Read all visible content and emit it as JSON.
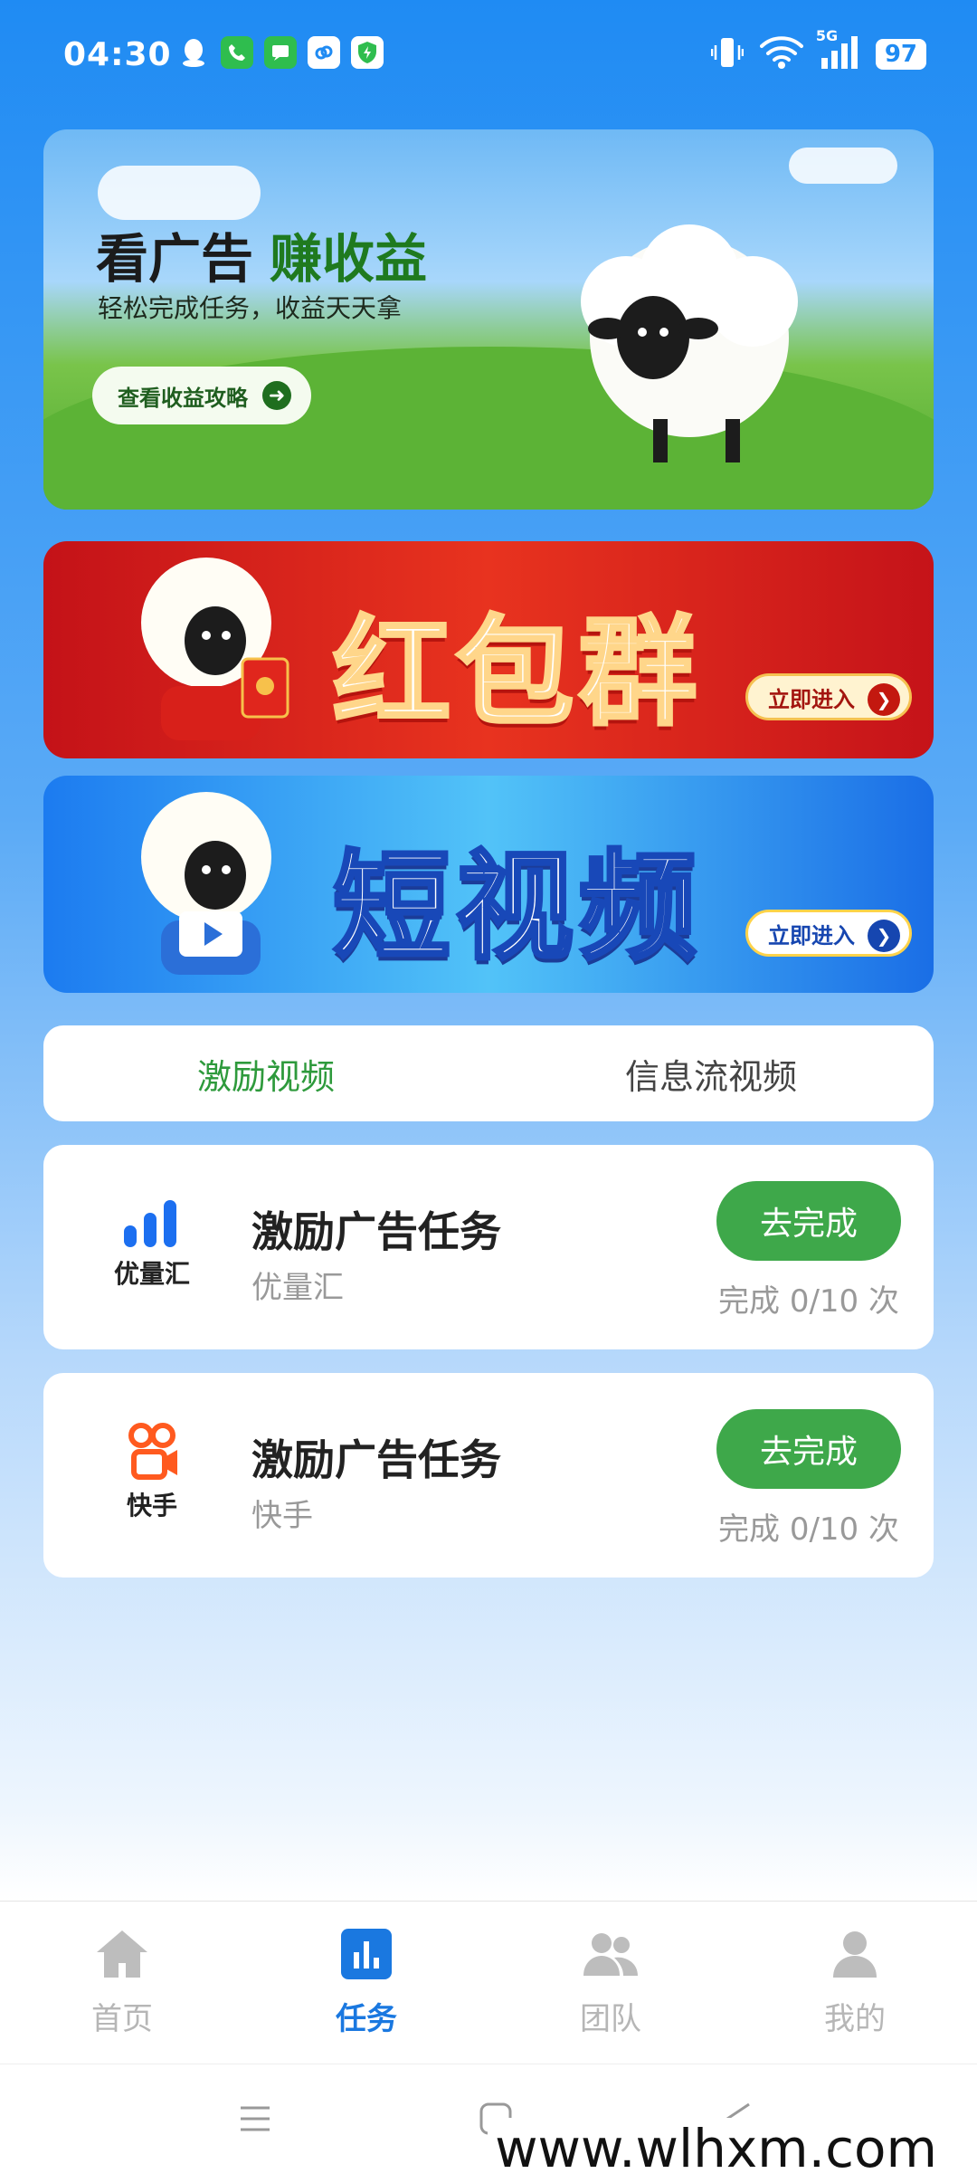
{
  "status_bar": {
    "time": "04:30",
    "battery": "97",
    "network": "5G"
  },
  "banners": {
    "earn": {
      "title_black": "看广告",
      "title_green": "赚收益",
      "subtitle": "轻松完成任务，收益天天拿",
      "button_label": "查看收益攻略"
    },
    "red_packet": {
      "title": "红包群",
      "button_label": "立即进入"
    },
    "short_video": {
      "title": "短视频",
      "button_label": "立即进入"
    }
  },
  "tabs": [
    {
      "label": "激励视频",
      "active": true
    },
    {
      "label": "信息流视频",
      "active": false
    }
  ],
  "tasks": [
    {
      "logo_label": "优量汇",
      "name": "激励广告任务",
      "source": "优量汇",
      "button_label": "去完成",
      "progress": "完成 0/10 次"
    },
    {
      "logo_label": "快手",
      "name": "激励广告任务",
      "source": "快手",
      "button_label": "去完成",
      "progress": "完成 0/10 次"
    }
  ],
  "bottom_nav": [
    {
      "label": "首页",
      "icon": "home-icon"
    },
    {
      "label": "任务",
      "icon": "task-chart-icon"
    },
    {
      "label": "团队",
      "icon": "team-icon"
    },
    {
      "label": "我的",
      "icon": "profile-icon"
    }
  ],
  "watermark": "www.wlhxm.com",
  "colors": {
    "primary_blue": "#1a78e0",
    "green": "#3ea84a",
    "tab_active": "#2e9a3c"
  }
}
